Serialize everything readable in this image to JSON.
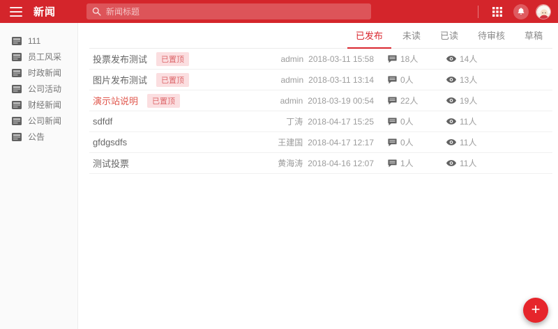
{
  "header": {
    "title": "新闻",
    "search_placeholder": "新闻标题",
    "icons": [
      "menu-icon",
      "search-icon",
      "apps-grid-icon",
      "bell-icon",
      "user-avatar"
    ]
  },
  "sidebar": {
    "items": [
      {
        "label": "111"
      },
      {
        "label": "员工风采"
      },
      {
        "label": "时政新闻"
      },
      {
        "label": "公司活动"
      },
      {
        "label": "财经新闻"
      },
      {
        "label": "公司新闻"
      },
      {
        "label": "公告"
      }
    ]
  },
  "tabs": [
    {
      "label": "已发布",
      "active": true
    },
    {
      "label": "未读",
      "active": false
    },
    {
      "label": "已读",
      "active": false
    },
    {
      "label": "待审核",
      "active": false
    },
    {
      "label": "草稿",
      "active": false
    }
  ],
  "list": {
    "rows": [
      {
        "title": "投票发布测试",
        "badge": "已置顶",
        "highlight": false,
        "author": "admin",
        "datetime": "2018-03-11 15:58",
        "comments": "18人",
        "views": "14人"
      },
      {
        "title": "图片发布测试",
        "badge": "已置顶",
        "highlight": false,
        "author": "admin",
        "datetime": "2018-03-11 13:14",
        "comments": "0人",
        "views": "13人"
      },
      {
        "title": "演示站说明",
        "badge": "已置顶",
        "highlight": true,
        "author": "admin",
        "datetime": "2018-03-19 00:54",
        "comments": "22人",
        "views": "19人"
      },
      {
        "title": "sdfdf",
        "badge": null,
        "highlight": false,
        "author": "丁涛",
        "datetime": "2018-04-17 15:25",
        "comments": "0人",
        "views": "11人"
      },
      {
        "title": "gfdgsdfs",
        "badge": null,
        "highlight": false,
        "author": "王建国",
        "datetime": "2018-04-17 12:17",
        "comments": "0人",
        "views": "11人"
      },
      {
        "title": "测试投票",
        "badge": null,
        "highlight": false,
        "author": "黄海涛",
        "datetime": "2018-04-16 12:07",
        "comments": "1人",
        "views": "11人"
      }
    ]
  },
  "fab": {
    "label": "+"
  },
  "colors": {
    "header_bg": "#d4252b",
    "accent_red": "#d9262e",
    "fab_red": "#e6252b",
    "badge_bg": "#fbdee0",
    "badge_text": "#dd686c",
    "highlight_title": "#e0584e",
    "sidebar_bg": "#fafafa"
  }
}
